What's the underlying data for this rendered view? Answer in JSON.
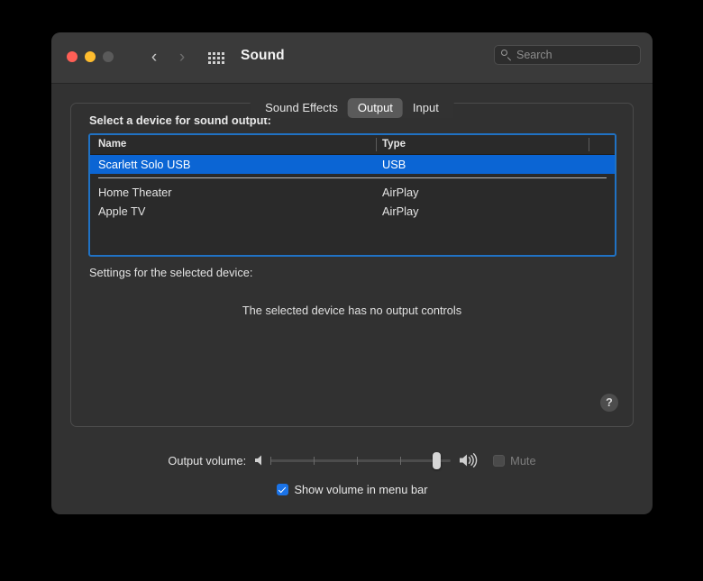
{
  "window": {
    "title": "Sound",
    "traffic_lights": [
      "close-red",
      "minimize-yellow",
      "zoom-disabled-gray"
    ],
    "nav": {
      "back": "‹",
      "forward": "›"
    },
    "grid_icon": "show-all-grid-icon"
  },
  "search": {
    "placeholder": "Search",
    "value": "",
    "icon": "search-icon"
  },
  "tabs": [
    {
      "label": "Sound Effects",
      "active": false
    },
    {
      "label": "Output",
      "active": true
    },
    {
      "label": "Input",
      "active": false
    }
  ],
  "main": {
    "select_device_label": "Select a device for sound output:",
    "settings_label": "Settings for the selected device:",
    "no_controls_message": "The selected device has no output controls",
    "help_label": "?"
  },
  "device_table": {
    "columns": [
      "Name",
      "Type"
    ],
    "rows": [
      {
        "name": "Scarlett Solo USB",
        "type": "USB",
        "selected": true
      },
      {
        "name": "Home Theater",
        "type": "AirPlay",
        "selected": false
      },
      {
        "name": "Apple TV",
        "type": "AirPlay",
        "selected": false
      }
    ]
  },
  "volume": {
    "label": "Output volume:",
    "min_icon": "speaker-low-icon",
    "max_icon": "speaker-high-icon",
    "level_percent": 94,
    "mute": {
      "label": "Mute",
      "checked": false,
      "disabled": true
    }
  },
  "menu_bar_option": {
    "label": "Show volume in menu bar",
    "checked": true
  },
  "colors": {
    "accent_blue": "#0b65d4",
    "focus_ring": "#2072c4",
    "checkbox_blue": "#1a73e8",
    "window_bg": "#323232",
    "titlebar_bg": "#3a3a3a"
  }
}
